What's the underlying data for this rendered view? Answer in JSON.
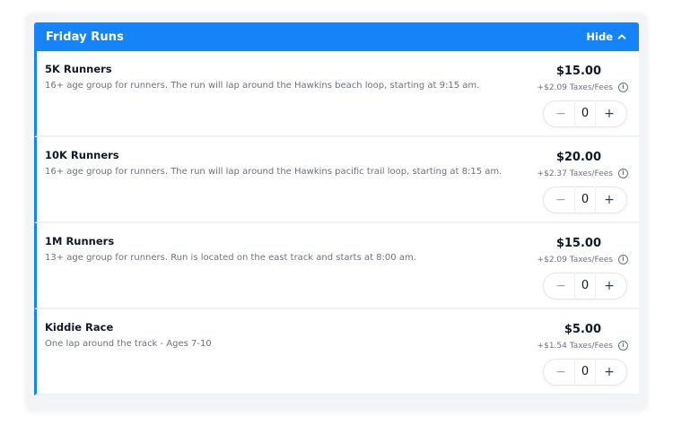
{
  "section": {
    "title": "Friday Runs",
    "hide_label": "Hide"
  },
  "items": [
    {
      "title": "5K Runners",
      "description": "16+ age group for runners. The run will lap around the Hawkins beach loop, starting at 9:15 am.",
      "price": "$15.00",
      "fees": "+$2.09 Taxes/Fees",
      "quantity": "0"
    },
    {
      "title": "10K Runners",
      "description": "16+ age group for runners. The run will lap around the Hawkins pacific trail loop, starting at 8:15 am.",
      "price": "$20.00",
      "fees": "+$2.37 Taxes/Fees",
      "quantity": "0"
    },
    {
      "title": "1M Runners",
      "description": "13+ age group for runners. Run is located on the east track and starts at 8:00 am.",
      "price": "$15.00",
      "fees": "+$2.09 Taxes/Fees",
      "quantity": "0"
    },
    {
      "title": "Kiddie Race",
      "description": "One lap around the track - Ages 7-10",
      "price": "$5.00",
      "fees": "+$1.54 Taxes/Fees",
      "quantity": "0"
    }
  ],
  "icons": {
    "info": "i",
    "minus": "−",
    "plus": "+",
    "chevron": "chevron-up-icon"
  },
  "colors": {
    "accent": "#1684f8",
    "text_dark": "#111827",
    "text_muted": "#6b7280"
  }
}
